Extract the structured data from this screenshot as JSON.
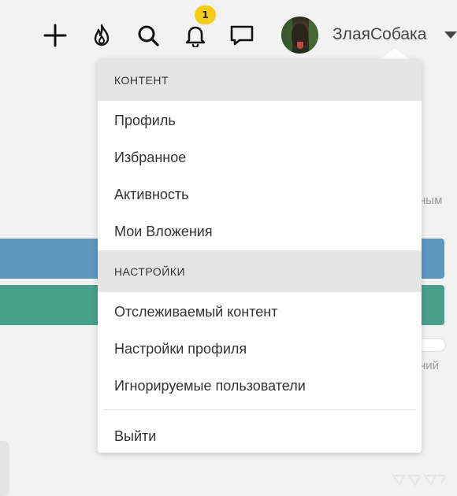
{
  "header": {
    "notification_count": "1",
    "username": "ЗлаяСобака"
  },
  "background": {
    "fragment_1": "ным",
    "fragment_2": "ний"
  },
  "menu": {
    "content_section": "КОНТЕНТ",
    "content_items": [
      "Профиль",
      "Избранное",
      "Активность",
      "Мои Вложения"
    ],
    "settings_section": "НАСТРОЙКИ",
    "settings_items": [
      "Отслеживаемый контент",
      "Настройки профиля",
      "Игнорируемые пользователи"
    ],
    "logout": "Выйти"
  },
  "colors": {
    "badge": "#f5cc14",
    "bar_blue": "#5e97bf",
    "bar_green": "#47a08a"
  }
}
